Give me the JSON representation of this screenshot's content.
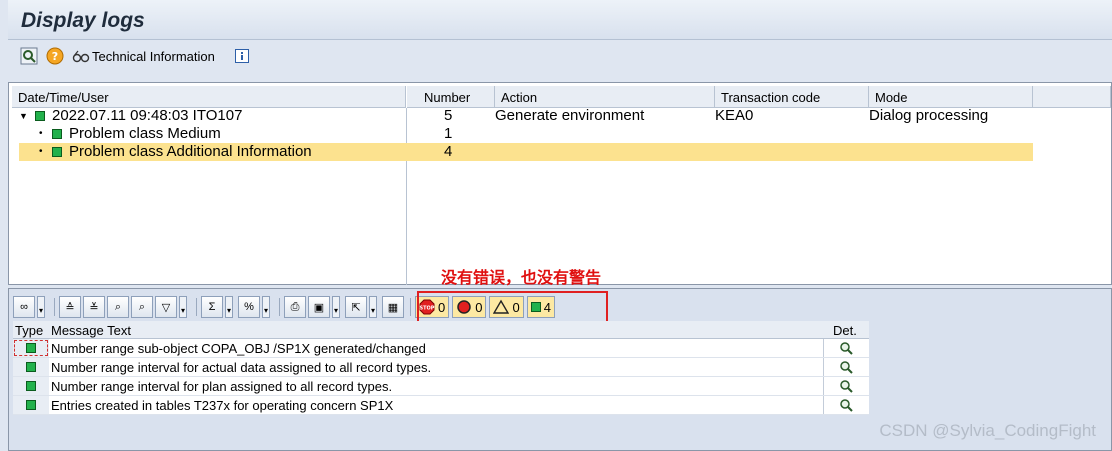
{
  "window": {
    "title": "Display logs"
  },
  "toolbar": {
    "technical_info_label": "Technical Information"
  },
  "log_tree": {
    "columns": [
      "Date/Time/User",
      "Number",
      "Action",
      "Transaction code",
      "Mode"
    ],
    "root": {
      "label": "2022.07.11  09:48:03  ITO107",
      "number": "5",
      "action": "Generate environment",
      "tcode": "KEA0",
      "mode": "Dialog processing"
    },
    "children": [
      {
        "label": "Problem class Medium",
        "number": "1"
      },
      {
        "label": "Problem class Additional Information",
        "number": "4"
      }
    ]
  },
  "annotation": {
    "text": "没有错误，也没有警告",
    "color": "#e01010"
  },
  "counters": {
    "stop": "0",
    "error": "0",
    "warning": "0",
    "success": "4"
  },
  "messages": {
    "columns": {
      "type": "Type",
      "text": "Message Text",
      "detail": "Det."
    },
    "rows": [
      {
        "text": "Number range sub-object COPA_OBJ  /SP1X generated/changed"
      },
      {
        "text": "Number range interval for actual data assigned to all record types."
      },
      {
        "text": "Number range interval for plan assigned to all record types."
      },
      {
        "text": "Entries created in tables T237x for operating concern SP1X"
      }
    ]
  },
  "watermark": "CSDN @Sylvia_CodingFight",
  "colors": {
    "highlight": "#fce28f",
    "success": "#22b14c",
    "stop": "#e02020"
  }
}
